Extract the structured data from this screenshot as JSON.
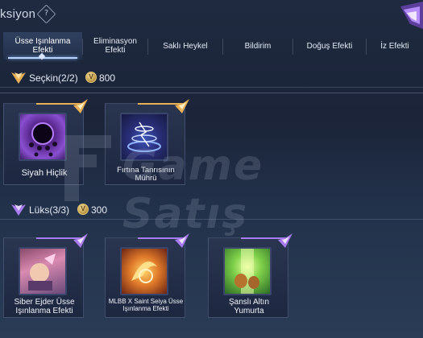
{
  "header": {
    "title": "ksiyon",
    "help_glyph": "?",
    "help_icon": "question-diamond-icon",
    "emblem_icon": "diamond-emblem-icon"
  },
  "tabs": [
    {
      "label": "Üsse Işınlanma Efekti",
      "active": true
    },
    {
      "label": "Eliminasyon Efekti",
      "active": false
    },
    {
      "label": "Saklı Heykel",
      "active": false
    },
    {
      "label": "Bildirim",
      "active": false
    },
    {
      "label": "Doğuş Efekti",
      "active": false
    },
    {
      "label": "İz Efekti",
      "active": false
    }
  ],
  "sections": [
    {
      "label": "Seçkin(2/2)",
      "price": "800",
      "accent": "#e8b057",
      "items": [
        {
          "name": "Siyah Hiçlik",
          "icon": "black-void-icon"
        },
        {
          "name": "Fırtına Tanrısının Mührü",
          "icon": "storm-seal-icon"
        }
      ]
    },
    {
      "label": "Lüks(3/3)",
      "price": "300",
      "accent": "#a87cf0",
      "items": [
        {
          "name": "Siber Ejder Üsse Işınlanma Efekti",
          "icon": "cyber-dragon-icon"
        },
        {
          "name": "MLBB X Saint Seiya Üsse Işınlanma Efekti",
          "icon": "saint-seiya-icon"
        },
        {
          "name": "Şanslı Altın Yumurta",
          "icon": "golden-egg-icon"
        }
      ]
    }
  ],
  "watermark": {
    "text": "Game Satış"
  }
}
